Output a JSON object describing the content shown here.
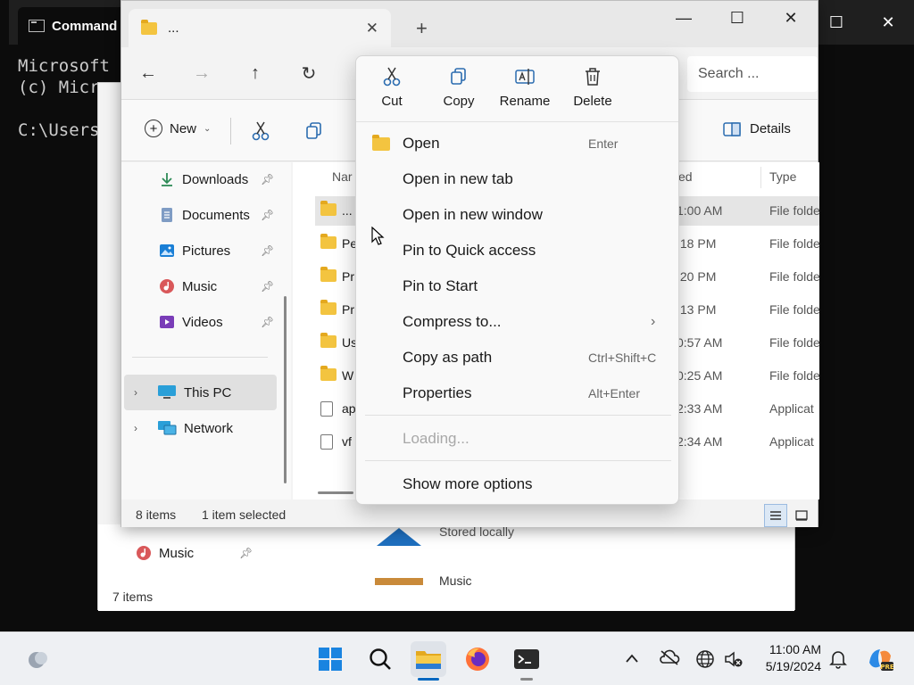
{
  "terminal": {
    "tab_title": "Command",
    "lines": [
      "Microsoft",
      "(c) Micr",
      "",
      "C:\\Users"
    ]
  },
  "explorer_back": {
    "nav_item": "Music",
    "status": "7 items",
    "stored_label": "Stored locally",
    "music_label": "Music"
  },
  "explorer": {
    "tab_title": "...",
    "search_placeholder": "Search ...",
    "toolbar": {
      "new_label": "New",
      "details_label": "Details"
    },
    "nav_items": [
      {
        "label": "Downloads",
        "icon": "download-icon"
      },
      {
        "label": "Documents",
        "icon": "documents-icon"
      },
      {
        "label": "Pictures",
        "icon": "pictures-icon"
      },
      {
        "label": "Music",
        "icon": "music-icon"
      },
      {
        "label": "Videos",
        "icon": "videos-icon"
      }
    ],
    "nav_this_pc": "This PC",
    "nav_network": "Network",
    "columns": {
      "name": "Nar",
      "modified": "ed",
      "type": "Type"
    },
    "rows": [
      {
        "name": "...",
        "date": "1:00 AM",
        "type": "File folde",
        "kind": "folder"
      },
      {
        "name": "Pe",
        "date": ":18 PM",
        "type": "File folde",
        "kind": "folder"
      },
      {
        "name": "Pr",
        "date": ":20 PM",
        "type": "File folde",
        "kind": "folder"
      },
      {
        "name": "Pr",
        "date": ":13 PM",
        "type": "File folde",
        "kind": "folder"
      },
      {
        "name": "Us",
        "date": "0:57 AM",
        "type": "File folde",
        "kind": "folder"
      },
      {
        "name": "W",
        "date": "0:25 AM",
        "type": "File folde",
        "kind": "folder"
      },
      {
        "name": "ap",
        "date": "2:33 AM",
        "type": "Applicat",
        "kind": "file"
      },
      {
        "name": "vf",
        "date": "2:34 AM",
        "type": "Applicat",
        "kind": "file"
      }
    ],
    "status": {
      "count": "8 items",
      "selected": "1 item selected"
    }
  },
  "context_menu": {
    "quick_actions": [
      {
        "label": "Cut",
        "icon": "cut-icon"
      },
      {
        "label": "Copy",
        "icon": "copy-icon"
      },
      {
        "label": "Rename",
        "icon": "rename-icon"
      },
      {
        "label": "Delete",
        "icon": "delete-icon"
      }
    ],
    "items": [
      {
        "label": "Open",
        "shortcut": "Enter"
      },
      {
        "label": "Open in new tab",
        "shortcut": ""
      },
      {
        "label": "Open in new window",
        "shortcut": ""
      },
      {
        "label": "Pin to Quick access",
        "shortcut": ""
      },
      {
        "label": "Pin to Start",
        "shortcut": ""
      },
      {
        "label": "Compress to...",
        "shortcut": ""
      },
      {
        "label": "Copy as path",
        "shortcut": "Ctrl+Shift+C"
      },
      {
        "label": "Properties",
        "shortcut": "Alt+Enter"
      }
    ],
    "loading": "Loading...",
    "show_more": "Show more options"
  },
  "taskbar": {
    "time": "11:00 AM",
    "date": "5/19/2024"
  },
  "colors": {
    "accent": "#0067c0",
    "folder": "#f3c440"
  }
}
